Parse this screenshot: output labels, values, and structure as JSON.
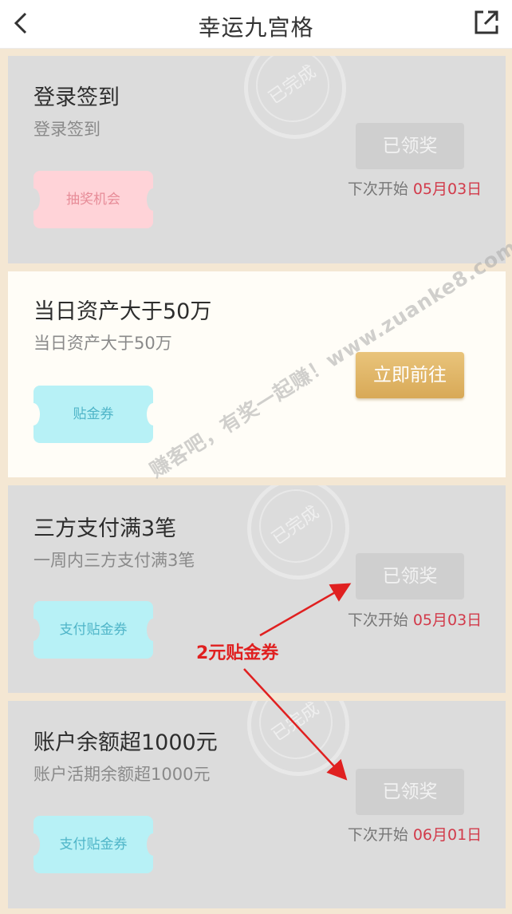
{
  "header": {
    "title": "幸运九宫格",
    "back_icon": "chevron-left-icon",
    "share_icon": "share-icon"
  },
  "tasks": [
    {
      "title": "登录签到",
      "subtitle": "登录签到",
      "reward": "抽奖机会",
      "button": "已领奖",
      "next_label": "下次开始",
      "next_date": "05月03日",
      "stamp": "已完成"
    },
    {
      "title": "当日资产大于50万",
      "subtitle": "当日资产大于50万",
      "reward": "贴金券",
      "button": "立即前往"
    },
    {
      "title": "三方支付满3笔",
      "subtitle": "一周内三方支付满3笔",
      "reward": "支付贴金券",
      "button": "已领奖",
      "next_label": "下次开始",
      "next_date": "05月03日",
      "stamp": "已完成"
    },
    {
      "title": "账户余额超1000元",
      "subtitle": "账户活期余额超1000元",
      "reward": "支付贴金券",
      "button": "已领奖",
      "next_label": "下次开始",
      "next_date": "06月01日",
      "stamp": "已完成"
    }
  ],
  "watermark": "赚客吧，有奖一起赚！www.zuanke8.com",
  "annotation": "2元贴金券",
  "colors": {
    "date_red": "#d23a4a",
    "gold_button": "#dcaf5f",
    "annotation_red": "#e02020"
  }
}
